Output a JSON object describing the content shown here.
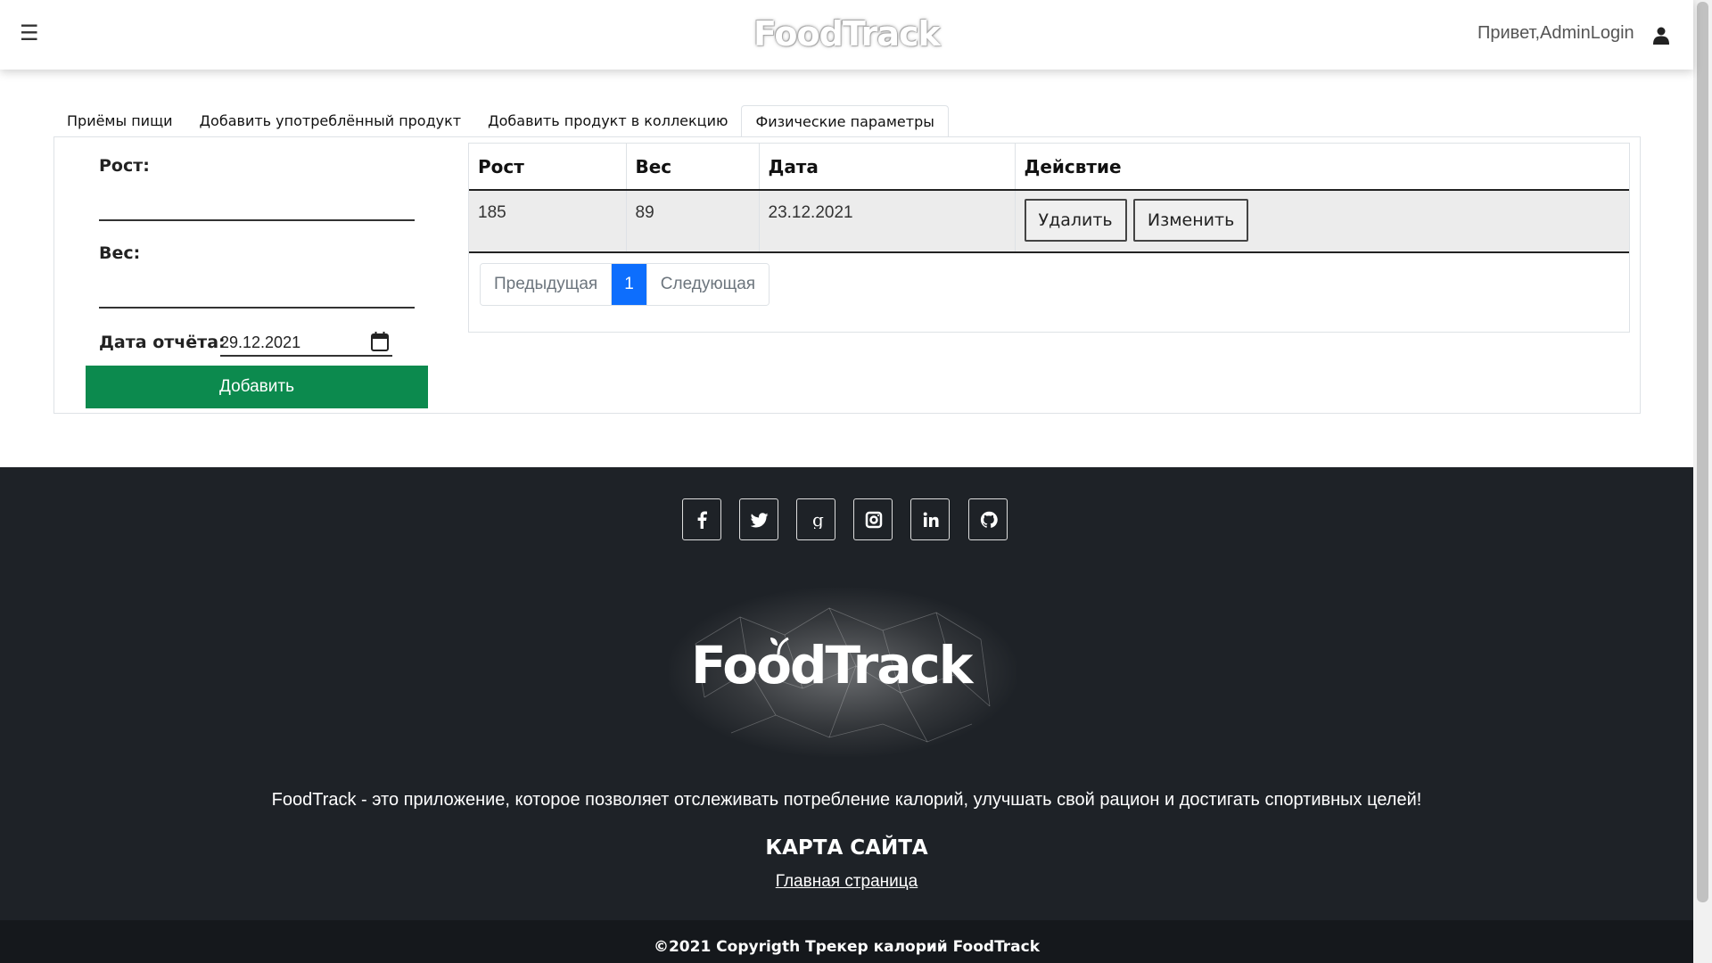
{
  "header": {
    "menu_icon": "hamburger-icon",
    "logo_text": "FoodTrack",
    "greeting": "Привет,AdminLogin",
    "user_icon": "user-icon"
  },
  "tabs": [
    {
      "label": "Приёмы пищи"
    },
    {
      "label": "Добавить употреблённый продукт"
    },
    {
      "label": "Добавить продукт в коллекцию"
    },
    {
      "label": "Физические параметры",
      "active": true
    }
  ],
  "form": {
    "height_label": "Рост:",
    "height_value": "",
    "weight_label": "Вес:",
    "weight_value": "",
    "date_label": "Дата отчёта:",
    "date_value": "29.12.2021",
    "calendar_icon": "calendar-icon",
    "add_button": "Добавить",
    "add_button_color": "#0c8a4e"
  },
  "table": {
    "columns": [
      "Рост",
      "Вес",
      "Дата",
      "Дейсвтие"
    ],
    "rows": [
      {
        "height": "185",
        "weight": "89",
        "date": "23.12.2021",
        "delete": "Удалить",
        "edit": "Изменить"
      }
    ]
  },
  "pagination": {
    "prev": "Предыдущая",
    "current": "1",
    "next": "Следующая",
    "active_color": "#0d6efd"
  },
  "footer": {
    "socials": [
      "facebook-icon",
      "twitter-icon",
      "google-icon",
      "instagram-icon",
      "linkedin-icon",
      "github-icon"
    ],
    "logo_text": "FoodTrack",
    "description": "FoodTrack - это приложение, которое позволяет отслеживать потребление калорий, улучшать свой рацион и достигать спортивных целей!",
    "sitemap_title": "КАРТА САЙТА",
    "sitemap_link": "Главная страница",
    "copyright": "©2021 Copyrigth Трекер калорий FoodTrack",
    "background": "#1e2227"
  }
}
